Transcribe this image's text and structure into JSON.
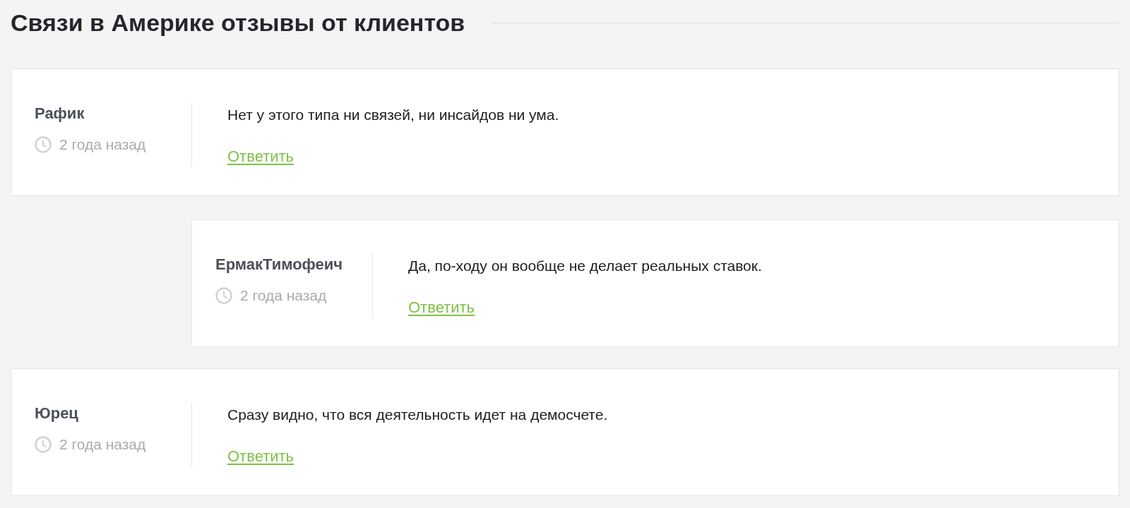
{
  "heading": {
    "title": "Связи в Америке отзывы от клиентов"
  },
  "comments": [
    {
      "author": "Рафик",
      "time": "2 года назад",
      "text": "Нет у этого типа ни связей, ни инсайдов ни ума.",
      "reply_link": "Ответить",
      "children": [
        {
          "author": "ЕрмакТимофеич",
          "time": "2 года назад",
          "text": "Да, по-ходу он вообще не делает реальных ставок.",
          "reply_link": "Ответить"
        }
      ]
    },
    {
      "author": "Юрец",
      "time": "2 года назад",
      "text": "Сразу видно, что вся деятельность идет на демосчете.",
      "reply_link": "Ответить"
    }
  ]
}
